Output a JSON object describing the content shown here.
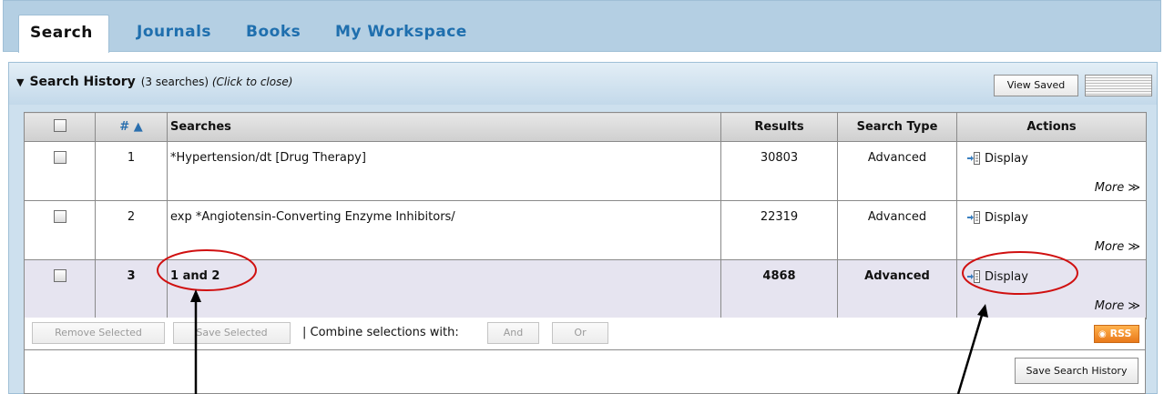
{
  "tabs": [
    {
      "label": "Search",
      "active": true
    },
    {
      "label": "Journals"
    },
    {
      "label": "Books"
    },
    {
      "label": "My Workspace"
    }
  ],
  "search_history": {
    "title": "Search History",
    "count_text": "(3 searches)",
    "close_hint": "(Click to close)",
    "view_saved_label": "View Saved"
  },
  "table": {
    "headers": {
      "num": "# ▲",
      "searches": "Searches",
      "results": "Results",
      "search_type": "Search Type",
      "actions": "Actions"
    },
    "rows": [
      {
        "num": "1",
        "search": "*Hypertension/dt [Drug Therapy]",
        "results": "30803",
        "type": "Advanced",
        "display": "Display",
        "more": "More ≫"
      },
      {
        "num": "2",
        "search": "exp *Angiotensin-Converting Enzyme Inhibitors/",
        "results": "22319",
        "type": "Advanced",
        "display": "Display",
        "more": "More ≫"
      },
      {
        "num": "3",
        "search": "1 and 2",
        "results": "4868",
        "type": "Advanced",
        "display": "Display",
        "more": "More ≫"
      }
    ]
  },
  "footer": {
    "remove_selected": "Remove Selected",
    "save_selected": "Save Selected",
    "combine_label": "| Combine selections with:",
    "and_label": "And",
    "or_label": "Or",
    "rss_label": "RSS",
    "save_history_label": "Save Search History"
  },
  "colors": {
    "tab_bar": "#b4cfe3",
    "tab_text": "#1f6fae",
    "panel": "#cde0ee",
    "highlight_row": "#e6e4f0",
    "annotation": "#d01010"
  },
  "icons": [
    "display-icon",
    "rss-icon",
    "list-view-icon",
    "collapse-arrow-icon"
  ]
}
